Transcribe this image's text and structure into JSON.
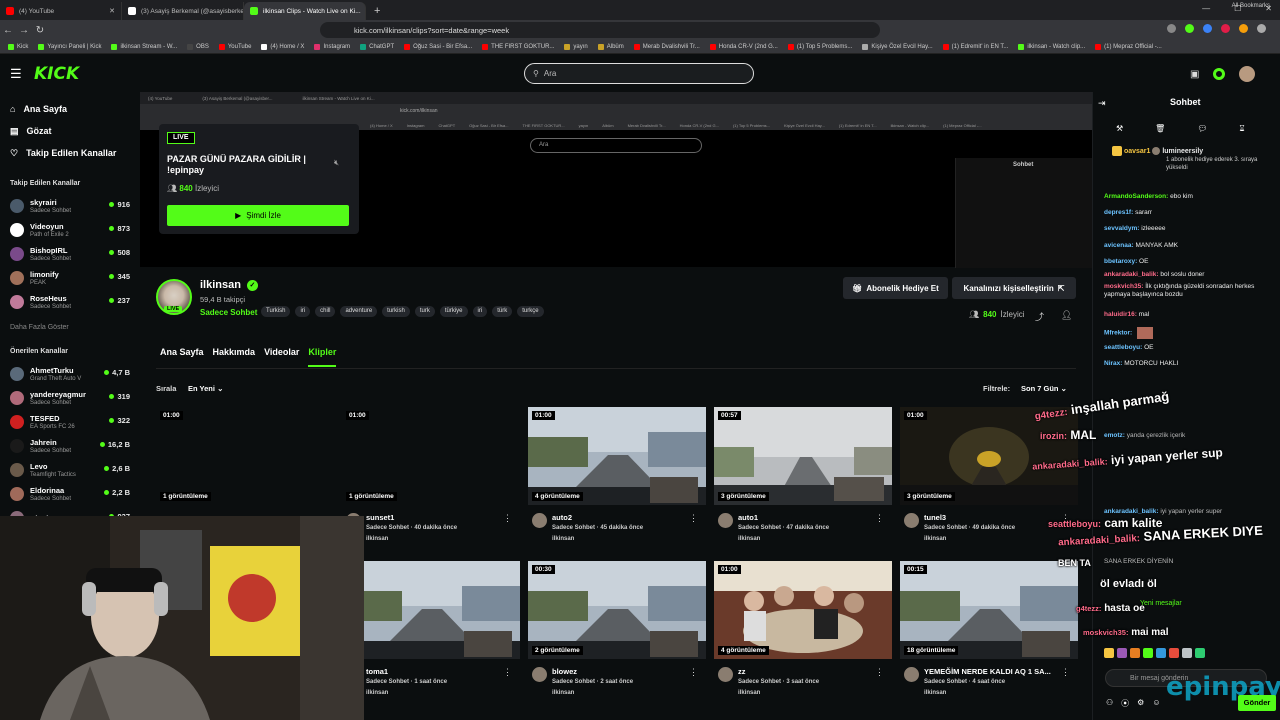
{
  "browser": {
    "tabs": [
      {
        "label": "(4) YouTube",
        "color": "#ff0000"
      },
      {
        "label": "(3) Asayiş Berkemal (@asayisberkem...",
        "color": "#ffffff"
      },
      {
        "label": "ilkinsan Clips - Watch Live on Ki...",
        "color": "#53fc18",
        "active": true
      },
      {
        "label": "+",
        "color": ""
      }
    ],
    "url": "kick.com/ilkinsan/clips?sort=date&range=week",
    "bookmarks": [
      "Kick",
      "Yayıncı Paneli | Kick",
      "ilkinsan Stream - W...",
      "OBS",
      "YouTube",
      "(4) Home / X",
      "Instagram",
      "ChatGPT",
      "Oğuz Sasi - Bir Efsa...",
      "THE FIRST GOKTUR...",
      "yayın",
      "Albüm",
      "Merab Dvalishvili Tr...",
      "Honda CR-V (2nd G...",
      "(1) Top 5 Problems...",
      "Kişiye Özel Evcil Hay...",
      "(1) Edremit' in EN T...",
      "ilkinsan - Watch clip...",
      "(1) Mepraz Official -..."
    ],
    "all_bookmarks": "All Bookmarks"
  },
  "header": {
    "logo": "KICK",
    "search_placeholder": "Ara"
  },
  "sidebar": {
    "nav": [
      {
        "label": "Ana Sayfa",
        "icon": "home-icon"
      },
      {
        "label": "Gözat",
        "icon": "browse-icon"
      },
      {
        "label": "Takip Edilen Kanallar",
        "icon": "heart-icon"
      }
    ],
    "followed_title": "Takip Edilen Kanallar",
    "followed": [
      {
        "name": "skyrairi",
        "game": "Sadece Sohbet",
        "viewers": "916",
        "color": "#4a5a6a"
      },
      {
        "name": "Videoyun",
        "game": "Path of Exile 2",
        "viewers": "873",
        "color": "#ffffff"
      },
      {
        "name": "BishopIRL",
        "game": "Sadece Sohbet",
        "viewers": "508",
        "color": "#7a4a8a"
      },
      {
        "name": "limonify",
        "game": "PEAK",
        "viewers": "345",
        "color": "#a0705a"
      },
      {
        "name": "RoseHeus",
        "game": "Sadece Sohbet",
        "viewers": "237",
        "color": "#c07a9a"
      }
    ],
    "more": "Daha Fazla Göster",
    "recommended_title": "Önerilen Kanallar",
    "recommended": [
      {
        "name": "AhmetTurku",
        "game": "Grand Theft Auto V",
        "viewers": "4,7 B",
        "color": "#5a6a7a"
      },
      {
        "name": "yandereyagmur",
        "game": "Sadece Sohbet",
        "viewers": "319",
        "color": "#b06a7a"
      },
      {
        "name": "TESFED",
        "game": "EA Sports FC 26",
        "viewers": "322",
        "color": "#d02020"
      },
      {
        "name": "Jahrein",
        "game": "Sadece Sohbet",
        "viewers": "16,2 B",
        "color": "#1a1a1a"
      },
      {
        "name": "Levo",
        "game": "Teamfight Tactics",
        "viewers": "2,6 B",
        "color": "#6a5a4a"
      },
      {
        "name": "Eldorinaa",
        "game": "Sadece Sohbet",
        "viewers": "2,2 B",
        "color": "#a06a5a"
      },
      {
        "name": "Blush",
        "game": "",
        "viewers": "937",
        "color": "#8a6a7a"
      }
    ]
  },
  "popup": {
    "live": "LIVE",
    "title": "PAZAR GÜNÜ PAZARA GİDİLİR | !epinpay",
    "viewers_num": "840",
    "viewers_label": "İzleyici",
    "watch": "Şimdi İzle"
  },
  "inner": {
    "tabs": [
      "(4) YouTube",
      "(3) Asayiş Berkemal (@asayisber...",
      "ilkinsan Stream - Watch Live on Ki..."
    ],
    "url": "kick.com/ilkinsan",
    "search": "Ara",
    "chat": "Sohbet"
  },
  "channel": {
    "name": "ilkinsan",
    "followers": "59,4 B takipçi",
    "category": "Sadece Sohbet",
    "live": "LIVE",
    "tags": [
      "Turkish",
      "iri",
      "chill",
      "adventure",
      "turkish",
      "turk",
      "türkiye",
      "iri",
      "türk",
      "turkçe"
    ],
    "gift_sub": "Abonelik Hediye Et",
    "customize": "Kanalınızı kişiselleştirin",
    "viewers_num": "840",
    "viewers_label": "İzleyici"
  },
  "tabs": [
    "Ana Sayfa",
    "Hakkımda",
    "Videolar",
    "Klipler"
  ],
  "sort": {
    "label": "Sırala",
    "value": "En Yeni"
  },
  "filter": {
    "label": "Filtrele:",
    "value": "Son 7 Gün"
  },
  "clips": [
    {
      "duration": "01:00",
      "views": "1 görüntüleme",
      "title": "",
      "category": "",
      "time": "",
      "user": "",
      "scene": "dark"
    },
    {
      "duration": "01:00",
      "views": "1 görüntüleme",
      "title": "sunset1",
      "category": "Sadece Sohbet",
      "time": "40 dakika önce",
      "user": "ilkinsan",
      "scene": "dark"
    },
    {
      "duration": "01:00",
      "views": "4 görüntüleme",
      "title": "auto2",
      "category": "Sadece Sohbet",
      "time": "45 dakika önce",
      "user": "ilkinsan",
      "scene": "road"
    },
    {
      "duration": "00:57",
      "views": "3 görüntüleme",
      "title": "auto1",
      "category": "Sadece Sohbet",
      "time": "47 dakika önce",
      "user": "ilkinsan",
      "scene": "fog"
    },
    {
      "duration": "01:00",
      "views": "3 görüntüleme",
      "title": "tunel3",
      "category": "Sadece Sohbet",
      "time": "49 dakika önce",
      "user": "ilkinsan",
      "scene": "tunnel"
    },
    {
      "duration": "",
      "views": "",
      "title": "toma1",
      "category": "Sadece Sohbet",
      "time": "1 saat önce",
      "user": "ilkinsan",
      "scene": "road"
    },
    {
      "duration": "00:30",
      "views": "2 görüntüleme",
      "title": "blowez",
      "category": "Sadece Sohbet",
      "time": "2 saat önce",
      "user": "ilkinsan",
      "scene": "road"
    },
    {
      "duration": "01:00",
      "views": "4 görüntüleme",
      "title": "zz",
      "category": "Sadece Sohbet",
      "time": "3 saat önce",
      "user": "ilkinsan",
      "scene": "party"
    },
    {
      "duration": "00:15",
      "views": "18 görüntüleme",
      "title": "YEMEĞİM NERDE KALDI AQ 1 SA...",
      "category": "Sadece Sohbet",
      "time": "4 saat önce",
      "user": "ilkinsan",
      "scene": "road"
    }
  ],
  "chat": {
    "title": "Sohbet",
    "gift_user": "oavsar1",
    "gift_user2": "lumineersily",
    "gift_text": "1 abonelik hediye ederek 3. sıraya yükseldi",
    "messages": [
      {
        "user": "ArmandoSanderson:",
        "text": "ebo kim",
        "color": "#53fc18"
      },
      {
        "user": "depres1f:",
        "text": "sararr",
        "color": "#6cc3ff"
      },
      {
        "user": "sevvaldym:",
        "text": "izleeeee",
        "color": "#6cc3ff"
      },
      {
        "user": "avicenaa:",
        "text": "MANYAK AMK",
        "color": "#6cc3ff"
      },
      {
        "user": "bbetaroxy:",
        "text": "OE",
        "color": "#6cc3ff"
      },
      {
        "user": "ankaradaki_balik:",
        "text": "bol soslu doner",
        "color": "#ff6b8a"
      },
      {
        "user": "moskvich35:",
        "text": "İlk çıktığında güzeldi sonradan herkes yapmaya başlayınca bozdu",
        "color": "#ff6b8a"
      },
      {
        "user": "haluidir16:",
        "text": "mal",
        "color": "#ff6b8a"
      },
      {
        "user": "Mfrektor:",
        "text": "",
        "color": "#6cc3ff"
      },
      {
        "user": "seattleboyu:",
        "text": "OE",
        "color": "#6cc3ff"
      },
      {
        "user": "Nirax:",
        "text": "MOTORCU HAKLI",
        "color": "#6cc3ff"
      }
    ],
    "overlay": [
      {
        "user": "g4tezz:",
        "text": "inşallah parmağ"
      },
      {
        "user": "irozin:",
        "text": "MAL"
      },
      {
        "user": "ankaradaki_balik:",
        "text": "iyi yapan yerler sup"
      },
      {
        "user": "seattleboyu:",
        "text": "cam kalite"
      },
      {
        "user": "ankaradaki_balik:",
        "text": "SANA ERKEK DIYE"
      },
      {
        "user": "",
        "text": "BEN TA"
      },
      {
        "user": "",
        "text": "öl evladı öl"
      },
      {
        "user": "g4tezz:",
        "text": "hasta oe"
      },
      {
        "user": "moskvich35:",
        "text": "mai mal"
      }
    ],
    "small_lines": [
      {
        "user": "emotz:",
        "text": "yanda çerezlik içerik"
      },
      {
        "user": "ankaradaki_balik:",
        "text": "iyi yapan yerler super"
      },
      {
        "user": "",
        "text": "SANA ERKEK DİYENİN"
      }
    ],
    "new_messages": "Yeni mesajlar",
    "input_placeholder": "Bir mesaj gönderin",
    "send": "Gönder",
    "brand_overlay": "epinpay"
  }
}
